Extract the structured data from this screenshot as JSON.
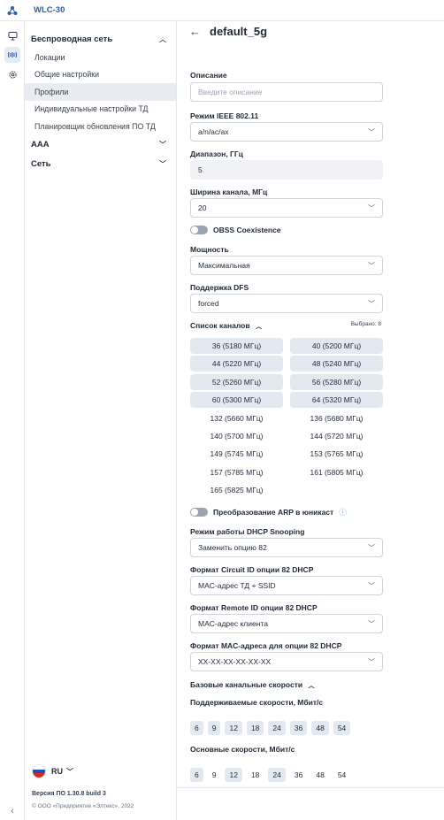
{
  "app": {
    "name": "WLC-30"
  },
  "sidebar": {
    "sections": [
      {
        "label": "Беспроводная сеть",
        "expanded": true,
        "items": [
          {
            "label": "Локации",
            "active": false
          },
          {
            "label": "Общие настройки",
            "active": false
          },
          {
            "label": "Профили",
            "active": true
          },
          {
            "label": "Индивидуальные настройки ТД",
            "active": false
          },
          {
            "label": "Планировщик обновления ПО ТД",
            "active": false
          }
        ]
      },
      {
        "label": "AAA",
        "expanded": false
      },
      {
        "label": "Сеть",
        "expanded": false
      }
    ],
    "language": "RU",
    "version": "Версия ПО 1.30.8 build 3",
    "copyright": "© ООО «Предприятие «Элтекс», 2022"
  },
  "page": {
    "title": "default_5g",
    "description": {
      "label": "Описание",
      "placeholder": "Введите описание"
    },
    "ieee_mode": {
      "label": "Режим IEEE 802.11",
      "value": "a/n/ac/ax"
    },
    "band": {
      "label": "Диапазон, ГГц",
      "value": "5"
    },
    "channel_width": {
      "label": "Ширина канала, МГц",
      "value": "20"
    },
    "obss": {
      "label": "OBSS Coexistence",
      "on": false
    },
    "power": {
      "label": "Мощность",
      "value": "Максимальная"
    },
    "dfs": {
      "label": "Поддержка DFS",
      "value": "forced"
    },
    "channels": {
      "label": "Список каналов",
      "selected_text": "Выбрано: 8",
      "rows": [
        [
          {
            "label": "36 (5180 МГц)",
            "selected": true
          },
          {
            "label": "40 (5200 МГц)",
            "selected": true
          }
        ],
        [
          {
            "label": "44 (5220 МГц)",
            "selected": true
          },
          {
            "label": "48 (5240 МГц)",
            "selected": true
          }
        ],
        [
          {
            "label": "52 (5260 МГц)",
            "selected": true
          },
          {
            "label": "56 (5280 МГц)",
            "selected": true
          }
        ],
        [
          {
            "label": "60 (5300 МГц)",
            "selected": true
          },
          {
            "label": "64 (5320 МГц)",
            "selected": true
          }
        ],
        [
          {
            "label": "132 (5660 МГц)",
            "selected": false
          },
          {
            "label": "136 (5680 МГц)",
            "selected": false
          }
        ],
        [
          {
            "label": "140 (5700 МГц)",
            "selected": false
          },
          {
            "label": "144 (5720 МГц)",
            "selected": false
          }
        ],
        [
          {
            "label": "149 (5745 МГц)",
            "selected": false
          },
          {
            "label": "153 (5765 МГц)",
            "selected": false
          }
        ],
        [
          {
            "label": "157 (5785 МГц)",
            "selected": false
          },
          {
            "label": "161 (5805 МГц)",
            "selected": false
          }
        ],
        [
          {
            "label": "165 (5825 МГц)",
            "selected": false
          },
          null
        ]
      ]
    },
    "arp": {
      "label": "Преобразование ARP в юникаст",
      "on": false
    },
    "dhcp_snooping": {
      "label": "Режим работы DHCP Snooping",
      "value": "Заменить опцию 82"
    },
    "circuit_id": {
      "label": "Формат Circuit ID опции 82 DHCP",
      "value": "MAC-адрес ТД + SSID"
    },
    "remote_id": {
      "label": "Формат Remote ID опции 82 DHCP",
      "value": "MAC-адрес клиента"
    },
    "mac_format": {
      "label": "Формат MAC-адреса для опции 82 DHCP",
      "value": "XX-XX-XX-XX-XX-XX"
    },
    "base_rates": {
      "label": "Базовые канальные скорости",
      "supported_label": "Поддерживаемые скорости, Мбит/с",
      "supported": [
        {
          "v": "6",
          "selected": true
        },
        {
          "v": "9",
          "selected": true
        },
        {
          "v": "12",
          "selected": true
        },
        {
          "v": "18",
          "selected": true
        },
        {
          "v": "24",
          "selected": true
        },
        {
          "v": "36",
          "selected": true
        },
        {
          "v": "48",
          "selected": true
        },
        {
          "v": "54",
          "selected": true
        }
      ],
      "basic_label": "Основные скорости, Мбит/с",
      "basic": [
        {
          "v": "6",
          "selected": true
        },
        {
          "v": "9",
          "selected": false
        },
        {
          "v": "12",
          "selected": true
        },
        {
          "v": "18",
          "selected": false
        },
        {
          "v": "24",
          "selected": true
        },
        {
          "v": "36",
          "selected": false
        },
        {
          "v": "48",
          "selected": false
        },
        {
          "v": "54",
          "selected": false
        }
      ]
    }
  },
  "colors": {
    "accent": "#2f5fa8",
    "chip_selected": "#e3e9f1",
    "active_row": "#e9edf2"
  }
}
